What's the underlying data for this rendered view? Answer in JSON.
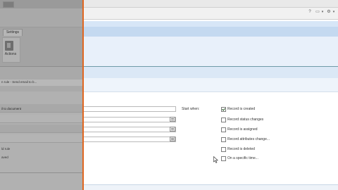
{
  "left_panel": {
    "settings_tab": "Settings",
    "actions_label": "Actions",
    "breadcrumb": "n rule - Send email to b...",
    "row_label": "il to document",
    "label_rule": "ld rule",
    "label_2": "aved"
  },
  "toolbar": {
    "help_icon": "help-icon",
    "print_icon": "print-icon",
    "settings_icon": "gear-icon"
  },
  "form": {
    "start_when_label": "Start when:",
    "options": [
      {
        "label": "Record is created",
        "checked": true
      },
      {
        "label": "Record status changes",
        "checked": false
      },
      {
        "label": "Record is assigned",
        "checked": false
      },
      {
        "label": "Record attributes change...",
        "checked": false
      },
      {
        "label": "Record is deleted",
        "checked": false
      },
      {
        "label": "On a specific time...",
        "checked": false
      }
    ]
  },
  "colors": {
    "divider": "#e0661f",
    "ribbon_blue": "#c4d9f0",
    "dim_overlay": "#a9a9a9"
  }
}
